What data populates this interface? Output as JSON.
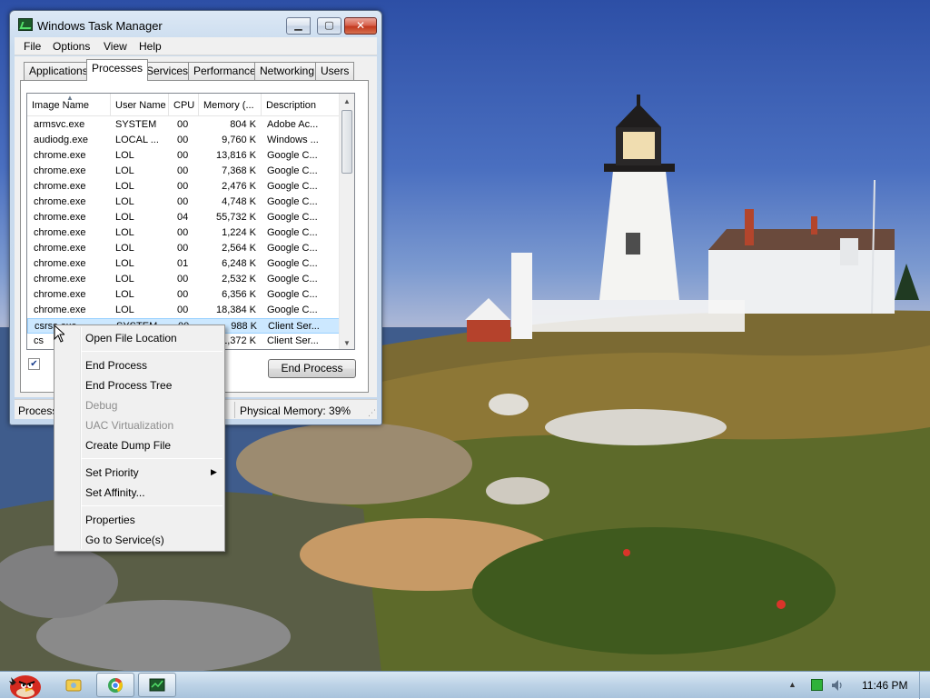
{
  "window": {
    "title": "Windows Task Manager",
    "menu": [
      "File",
      "Options",
      "View",
      "Help"
    ],
    "tabs": [
      "Applications",
      "Processes",
      "Services",
      "Performance",
      "Networking",
      "Users"
    ],
    "active_tab": "Processes"
  },
  "process_table": {
    "columns": [
      "Image Name",
      "User Name",
      "CPU",
      "Memory (...",
      "Description"
    ],
    "sort_column": "Image Name",
    "rows": [
      {
        "name": "armsvc.exe",
        "user": "SYSTEM",
        "cpu": "00",
        "mem": "804 K",
        "desc": "Adobe Ac..."
      },
      {
        "name": "audiodg.exe",
        "user": "LOCAL ...",
        "cpu": "00",
        "mem": "9,760 K",
        "desc": "Windows ..."
      },
      {
        "name": "chrome.exe",
        "user": "LOL",
        "cpu": "00",
        "mem": "13,816 K",
        "desc": "Google C..."
      },
      {
        "name": "chrome.exe",
        "user": "LOL",
        "cpu": "00",
        "mem": "7,368 K",
        "desc": "Google C..."
      },
      {
        "name": "chrome.exe",
        "user": "LOL",
        "cpu": "00",
        "mem": "2,476 K",
        "desc": "Google C..."
      },
      {
        "name": "chrome.exe",
        "user": "LOL",
        "cpu": "00",
        "mem": "4,748 K",
        "desc": "Google C..."
      },
      {
        "name": "chrome.exe",
        "user": "LOL",
        "cpu": "04",
        "mem": "55,732 K",
        "desc": "Google C..."
      },
      {
        "name": "chrome.exe",
        "user": "LOL",
        "cpu": "00",
        "mem": "1,224 K",
        "desc": "Google C..."
      },
      {
        "name": "chrome.exe",
        "user": "LOL",
        "cpu": "00",
        "mem": "2,564 K",
        "desc": "Google C..."
      },
      {
        "name": "chrome.exe",
        "user": "LOL",
        "cpu": "01",
        "mem": "6,248 K",
        "desc": "Google C..."
      },
      {
        "name": "chrome.exe",
        "user": "LOL",
        "cpu": "00",
        "mem": "2,532 K",
        "desc": "Google C..."
      },
      {
        "name": "chrome.exe",
        "user": "LOL",
        "cpu": "00",
        "mem": "6,356 K",
        "desc": "Google C..."
      },
      {
        "name": "chrome.exe",
        "user": "LOL",
        "cpu": "00",
        "mem": "18,384 K",
        "desc": "Google C..."
      },
      {
        "name": "csrss.exe",
        "user": "SYSTEM",
        "cpu": "00",
        "mem": "988 K",
        "desc": "Client Ser...",
        "selected": true
      },
      {
        "name": "cs",
        "user": "",
        "cpu": "",
        "mem": "1,372 K",
        "desc": "Client Ser..."
      }
    ]
  },
  "show_all_checkbox": {
    "checked": true,
    "label_visible": "S"
  },
  "end_process_label": "End Process",
  "statusbar": {
    "processes": "Process",
    "physical_memory": "Physical Memory: 39%"
  },
  "context_menu": {
    "items": [
      {
        "label": "Open File Location",
        "enabled": true
      },
      {
        "label": "End Process",
        "enabled": true
      },
      {
        "label": "End Process Tree",
        "enabled": true
      },
      {
        "label": "Debug",
        "enabled": false
      },
      {
        "label": "UAC Virtualization",
        "enabled": false
      },
      {
        "label": "Create Dump File",
        "enabled": true
      },
      {
        "label": "Set Priority",
        "enabled": true,
        "submenu": true
      },
      {
        "label": "Set Affinity...",
        "enabled": true
      },
      {
        "label": "Properties",
        "enabled": true
      },
      {
        "label": "Go to Service(s)",
        "enabled": true
      }
    ]
  },
  "taskbar": {
    "start_icon": "angry-bird-icon",
    "buttons": [
      "explorer-folder-icon",
      "chrome-icon",
      "task-manager-icon"
    ],
    "clock": "11:46 PM"
  },
  "colors": {
    "selection": "#cce8ff",
    "close_button": "#c2391f",
    "taskbar": "#bcd2e6"
  }
}
